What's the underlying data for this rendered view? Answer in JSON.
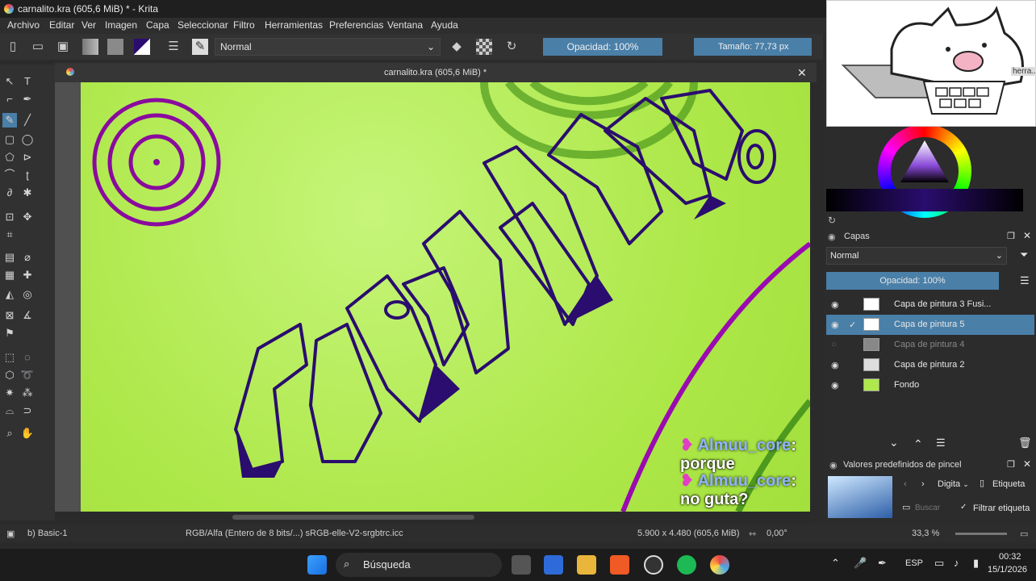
{
  "window": {
    "title": "carnalito.kra (605,6 MiB) * - Krita",
    "min": "—",
    "max": "❐",
    "close": "✕"
  },
  "menu": [
    "Archivo",
    "Editar",
    "Ver",
    "Imagen",
    "Capa",
    "Seleccionar",
    "Filtro",
    "Herramientas",
    "Preferencias",
    "Ventana",
    "Ayuda"
  ],
  "toolbar": {
    "blend_mode": "Normal",
    "opacity": "Opacidad: 100%",
    "size_label": "Tamaño:",
    "size_value": "77,73 px"
  },
  "document": {
    "tab_title": "carnalito.kra (605,6 MiB) *",
    "close": "✕"
  },
  "layers_panel": {
    "title": "Capas",
    "blend": "Normal",
    "opacity": "Opacidad:  100%",
    "layers": [
      {
        "name": "Capa de pintura 3 Fusi...",
        "visible": true,
        "selected": false
      },
      {
        "name": "Capa de pintura 5",
        "visible": true,
        "selected": true
      },
      {
        "name": "Capa de pintura 4",
        "visible": false,
        "selected": false
      },
      {
        "name": "Capa de pintura 2",
        "visible": true,
        "selected": false
      },
      {
        "name": "Fondo",
        "visible": true,
        "selected": false
      }
    ]
  },
  "brush_presets": {
    "title": "Valores predefinidos de pincel",
    "tag_select": "Digita",
    "tag_label": "Etiqueta",
    "search_placeholder": "Buscar",
    "filter_label": "Filtrar etiqueta"
  },
  "dock_tab_label": "herra...",
  "status": {
    "brush": "b) Basic-1",
    "color_space": "RGB/Alfa (Entero de 8 bits/...)  sRGB-elle-V2-srgbtrc.icc",
    "dimensions": "5.900 x 4.480 (605,6 MiB)",
    "rotation": "0,00°",
    "zoom": "33,3 %"
  },
  "chat": [
    {
      "nick": "Almuu_core",
      "msg": ": porque"
    },
    {
      "nick": "Almuu_core",
      "msg": ": no guta?"
    }
  ],
  "taskbar": {
    "search": "Búsqueda",
    "lang": "ESP",
    "time": "00:32",
    "date": "15/1/2026"
  },
  "colors": {
    "canvas": "#aee84a",
    "accent": "#4a7fa8",
    "ink": "#2a0d6e",
    "ring": "#8a0a9e"
  }
}
